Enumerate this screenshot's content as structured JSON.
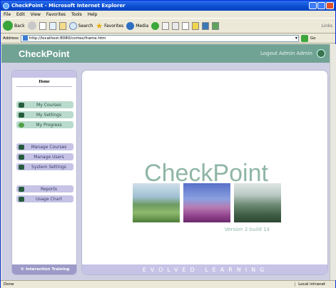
{
  "window": {
    "title": "CheckPoint - Microsoft Internet Explorer"
  },
  "menu": [
    "File",
    "Edit",
    "View",
    "Favorites",
    "Tools",
    "Help"
  ],
  "toolbar": {
    "back": "Back",
    "search": "Search",
    "favorites": "Favorites",
    "media": "Media",
    "links": "Links"
  },
  "address": {
    "label": "Address",
    "url": "http://localhost:8080/cortex/frame.htm",
    "go": "Go"
  },
  "header": {
    "logo": "CheckPoint",
    "logout": "Logout Admin Admin"
  },
  "sidebar": {
    "home": "Home",
    "items": [
      {
        "label": "My Courses"
      },
      {
        "label": "My Settings"
      },
      {
        "label": "My Progress"
      },
      {
        "label": "Manage Courses"
      },
      {
        "label": "Manage Users"
      },
      {
        "label": "System Settings"
      },
      {
        "label": "Reports"
      },
      {
        "label": "Usage Chart"
      }
    ],
    "footer": "© Interaction Training"
  },
  "main": {
    "brand": "CheckPoint",
    "version": "Version 2 build 14",
    "footer": "EVOLVED LEARNING"
  },
  "status": {
    "left": "Done",
    "zone": "Local intranet"
  },
  "colors": {
    "header": "#71a394",
    "green_item": "#b9dbcd",
    "purple_item": "#c6c3e6",
    "brand_text": "#8fb6a6"
  }
}
